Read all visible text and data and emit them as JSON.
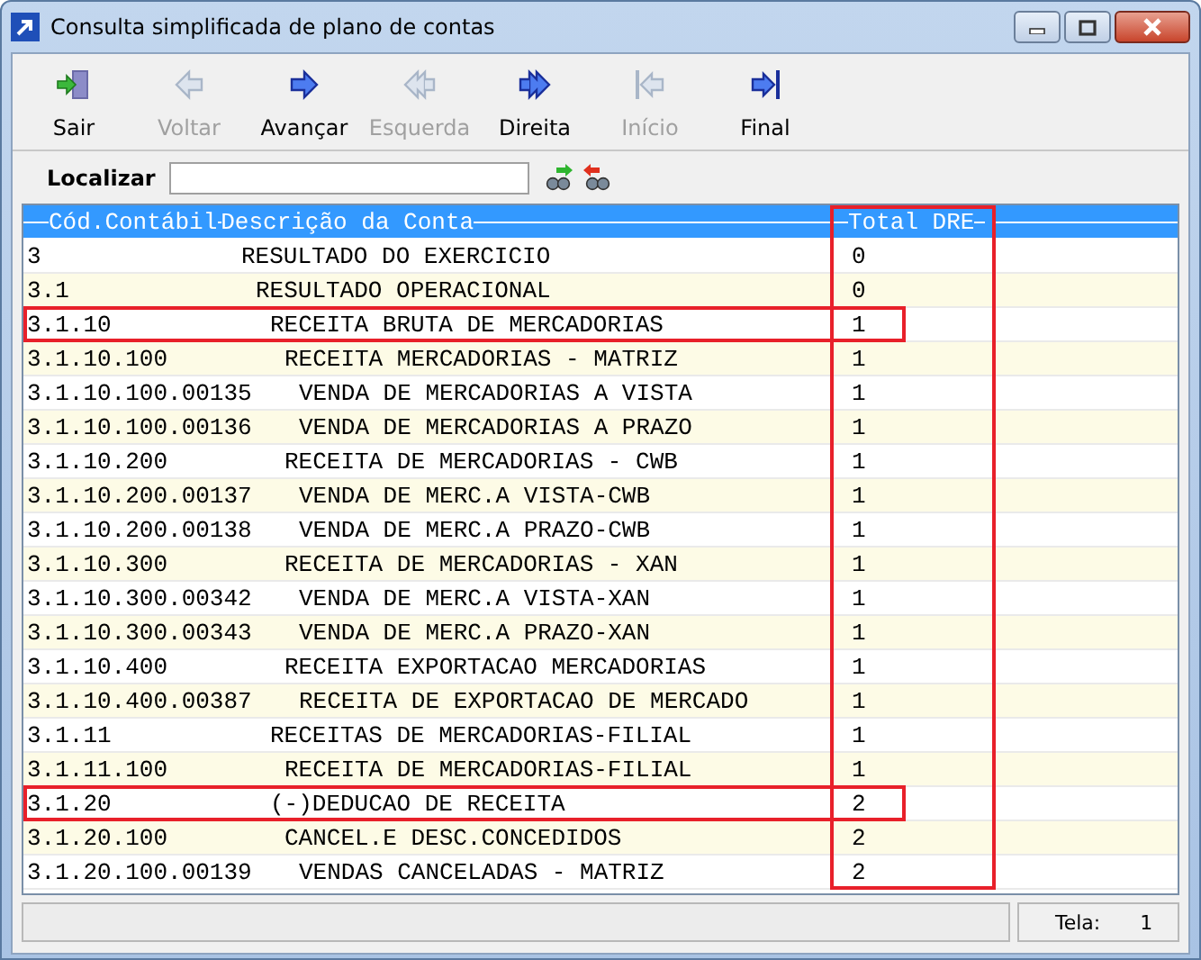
{
  "window": {
    "title": "Consulta simplificada de plano de contas"
  },
  "toolbar": [
    {
      "label": "Sair",
      "kind": "exit",
      "disabled": false
    },
    {
      "label": "Voltar",
      "kind": "prev",
      "disabled": true
    },
    {
      "label": "Avançar",
      "kind": "next",
      "disabled": false
    },
    {
      "label": "Esquerda",
      "kind": "double-prev",
      "disabled": true
    },
    {
      "label": "Direita",
      "kind": "double-next",
      "disabled": false
    },
    {
      "label": "Início",
      "kind": "first",
      "disabled": true
    },
    {
      "label": "Final",
      "kind": "last",
      "disabled": false
    }
  ],
  "search": {
    "label": "Localizar"
  },
  "table": {
    "columns": [
      {
        "label": "Cód.Contábil",
        "highlighted": false
      },
      {
        "label": "Descrição da Conta",
        "highlighted": false
      },
      {
        "label": "Total DRE",
        "highlighted": true
      }
    ],
    "rows": [
      {
        "code": "3",
        "description": "RESULTADO DO EXERCICIO",
        "total": "0",
        "highlighted": false
      },
      {
        "code": "3.1",
        "description": "RESULTADO OPERACIONAL",
        "total": "0",
        "highlighted": false
      },
      {
        "code": "3.1.10",
        "description": "RECEITA BRUTA DE MERCADORIAS",
        "total": "1",
        "highlighted": true
      },
      {
        "code": "3.1.10.100",
        "description": "RECEITA MERCADORIAS - MATRIZ",
        "total": "1",
        "highlighted": false
      },
      {
        "code": "3.1.10.100.00135",
        "description": "VENDA DE MERCADORIAS A VISTA",
        "total": "1",
        "highlighted": false
      },
      {
        "code": "3.1.10.100.00136",
        "description": "VENDA DE MERCADORIAS A PRAZO",
        "total": "1",
        "highlighted": false
      },
      {
        "code": "3.1.10.200",
        "description": "RECEITA DE MERCADORIAS - CWB",
        "total": "1",
        "highlighted": false
      },
      {
        "code": "3.1.10.200.00137",
        "description": "VENDA DE MERC.A VISTA-CWB",
        "total": "1",
        "highlighted": false
      },
      {
        "code": "3.1.10.200.00138",
        "description": "VENDA DE MERC.A PRAZO-CWB",
        "total": "1",
        "highlighted": false
      },
      {
        "code": "3.1.10.300",
        "description": "RECEITA DE MERCADORIAS - XAN",
        "total": "1",
        "highlighted": false
      },
      {
        "code": "3.1.10.300.00342",
        "description": "VENDA DE MERC.A VISTA-XAN",
        "total": "1",
        "highlighted": false
      },
      {
        "code": "3.1.10.300.00343",
        "description": "VENDA DE MERC.A PRAZO-XAN",
        "total": "1",
        "highlighted": false
      },
      {
        "code": "3.1.10.400",
        "description": "RECEITA EXPORTACAO MERCADORIAS",
        "total": "1",
        "highlighted": false
      },
      {
        "code": "3.1.10.400.00387",
        "description": "RECEITA DE EXPORTACAO DE MERCADO",
        "total": "1",
        "highlighted": false
      },
      {
        "code": "3.1.11",
        "description": "RECEITAS DE MERCADORIAS-FILIAL",
        "total": "1",
        "highlighted": false
      },
      {
        "code": "3.1.11.100",
        "description": "RECEITA DE MERCADORIAS-FILIAL",
        "total": "1",
        "highlighted": false
      },
      {
        "code": "3.1.20",
        "description": "(-)DEDUCAO DE RECEITA",
        "total": "2",
        "highlighted": true
      },
      {
        "code": "3.1.20.100",
        "description": "CANCEL.E DESC.CONCEDIDOS",
        "total": "2",
        "highlighted": false
      },
      {
        "code": "3.1.20.100.00139",
        "description": "VENDAS CANCELADAS - MATRIZ",
        "total": "2",
        "highlighted": false
      }
    ]
  },
  "status_bar": {
    "screen_label": "Tela:",
    "screen_value": "1"
  }
}
